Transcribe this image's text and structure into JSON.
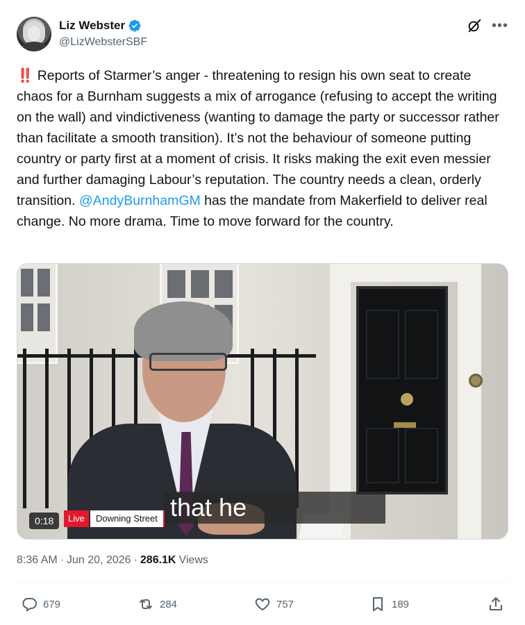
{
  "author": {
    "display_name": "Liz Webster",
    "handle": "@LizWebsterSBF",
    "verified": true
  },
  "tweet": {
    "prefix_emoji": "‼️",
    "text_part1": " Reports of Starmer’s anger - threatening to resign his own seat to create chaos for a Burnham suggests a mix of arrogance (refusing to accept the writing on the wall) and vindictiveness (wanting to damage the party or successor rather than facilitate a smooth transition). It’s not the behaviour of someone putting country or party first at a moment of crisis. It risks making the exit even messier and further damaging Labour’s reputation. The country needs a clean, orderly transition.",
    "mention": "@AndyBurnhamGM",
    "text_part2": " has the mandate from Makerfield to deliver real change. No more drama. Time to move forward for the country."
  },
  "video": {
    "duration": "0:18",
    "live_label": "Live",
    "location_label": "Downing Street",
    "caption": "that he"
  },
  "meta": {
    "time": "8:36 AM",
    "date": "Jun 20, 2026",
    "views_count": "286.1K",
    "views_label": "Views"
  },
  "actions": {
    "replies": "679",
    "reposts": "284",
    "likes": "757",
    "bookmarks": "189"
  },
  "icons": {
    "verified": "verified-badge-icon",
    "grok": "grok-icon",
    "more": "more-icon",
    "reply": "reply-icon",
    "repost": "repost-icon",
    "like": "like-icon",
    "bookmark": "bookmark-icon",
    "share": "share-icon"
  },
  "colors": {
    "link": "#1d9bf0",
    "text": "#0f1419",
    "secondary": "#536471",
    "live": "#e3182d"
  }
}
